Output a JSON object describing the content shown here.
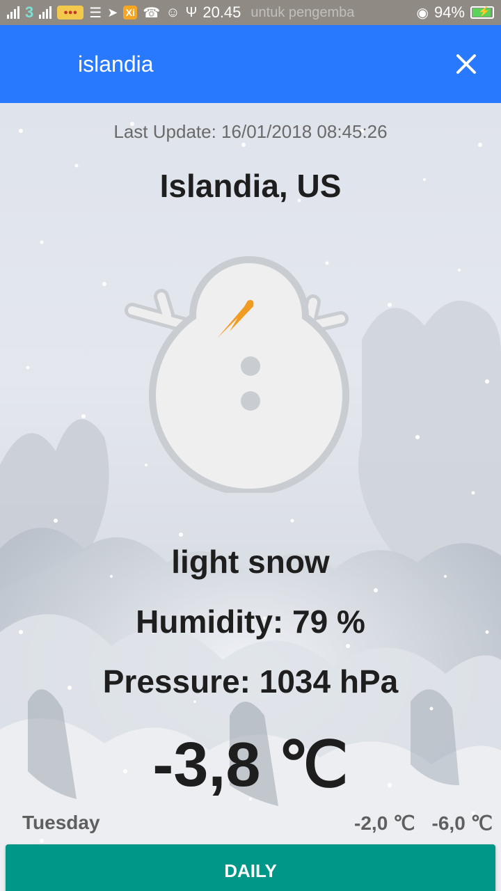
{
  "status_bar": {
    "carrier_badge": "3",
    "app_badge": "Xi",
    "time": "20.45",
    "ticker": "untuk pengemba",
    "battery": "94%"
  },
  "search": {
    "value": "islandia"
  },
  "weather": {
    "last_update": "Last Update: 16/01/2018 08:45:26",
    "city": "Islandia, US",
    "description": "light snow",
    "humidity": "Humidity: 79 %",
    "pressure": "Pressure: 1034 hPa",
    "temperature": "-3,8 ℃",
    "day": "Tuesday",
    "temp_max": "-2,0 ℃",
    "temp_min": "-6,0 ℃",
    "icon": "snowman-icon"
  },
  "actions": {
    "daily_label": "DAILY"
  },
  "colors": {
    "app_bar": "#2979ff",
    "button": "#009688",
    "status_bar": "#8f8a84",
    "carrot": "#f29b22"
  }
}
